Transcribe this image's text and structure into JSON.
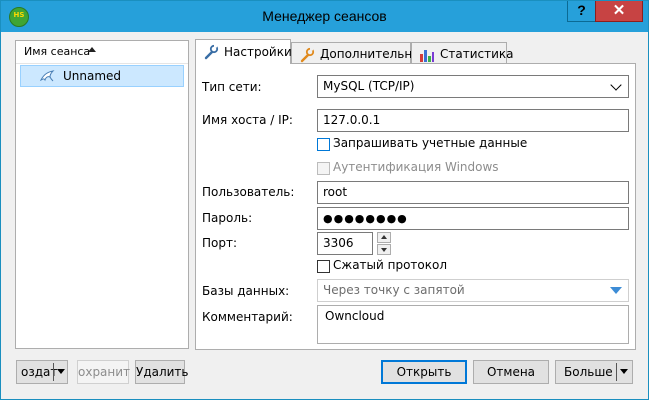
{
  "window": {
    "title": "Менеджер сеансов",
    "app_icon_text": "HS",
    "help_label": "?",
    "close_label": "✕"
  },
  "sessions": {
    "header": "Имя сеанса",
    "items": [
      {
        "label": "Unnamed",
        "icon": "dolphin-icon"
      }
    ]
  },
  "tabs": [
    {
      "label": "Настройки",
      "icon": "wrench-icon",
      "active": true
    },
    {
      "label": "Дополнительно",
      "icon": "wrench-orange-icon"
    },
    {
      "label": "Статистика",
      "icon": "bar-chart-icon"
    }
  ],
  "settings": {
    "network_type_label": "Тип сети:",
    "network_type_value": "MySQL (TCP/IP)",
    "host_label": "Имя хоста / IP:",
    "host_value": "127.0.0.1",
    "prompt_credentials_label": "Запрашивать учетные данные",
    "prompt_credentials_checked": false,
    "windows_auth_label": "Аутентификация Windows",
    "windows_auth_enabled": false,
    "user_label": "Пользователь:",
    "user_value": "root",
    "password_label": "Пароль:",
    "password_value": "●●●●●●●●",
    "port_label": "Порт:",
    "port_value": "3306",
    "compress_label": "Сжатый протокол",
    "compress_checked": false,
    "databases_label": "Базы данных:",
    "databases_placeholder": "Через точку с запятой",
    "comment_label": "Комментарий:",
    "comment_value": "Owncloud"
  },
  "buttons": {
    "new": "оздат",
    "save": "охранит",
    "delete": "Удалить",
    "open": "Открыть",
    "cancel": "Отмена",
    "more": "Больше"
  },
  "colors": {
    "titlebar": "#26a0da",
    "close": "#c74343",
    "selection": "#cce8ff",
    "accent": "#0078d7"
  }
}
